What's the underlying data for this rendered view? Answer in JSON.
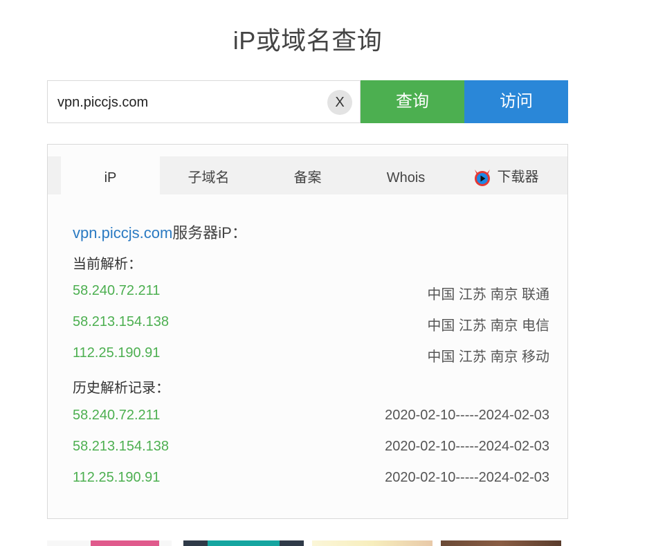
{
  "page": {
    "title": "iP或域名查询"
  },
  "search": {
    "value": "vpn.piccjs.com",
    "clear_label": "X",
    "query_label": "查询",
    "visit_label": "访问"
  },
  "tabs": [
    {
      "label": "iP",
      "active": true
    },
    {
      "label": "子域名",
      "active": false
    },
    {
      "label": "备案",
      "active": false
    },
    {
      "label": "Whois",
      "active": false
    },
    {
      "label": "下载器",
      "active": false,
      "icon": "devil-play-icon"
    }
  ],
  "result": {
    "domain": "vpn.piccjs.com",
    "heading_suffix": "服务器iP：",
    "current_label": "当前解析：",
    "current": [
      {
        "ip": "58.240.72.211",
        "location": "中国 江苏 南京 联通"
      },
      {
        "ip": "58.213.154.138",
        "location": "中国 江苏 南京 电信"
      },
      {
        "ip": "112.25.190.91",
        "location": "中国 江苏 南京 移动"
      }
    ],
    "history_label": "历史解析记录：",
    "history": [
      {
        "ip": "58.240.72.211",
        "range": "2020-02-10-----2024-02-03"
      },
      {
        "ip": "58.213.154.138",
        "range": "2020-02-10-----2024-02-03"
      },
      {
        "ip": "112.25.190.91",
        "range": "2020-02-10-----2024-02-03"
      }
    ]
  },
  "colors": {
    "query_button": "#4caf50",
    "visit_button": "#2a87d8",
    "ip_text": "#4caf50",
    "domain_link": "#2a7ac2"
  }
}
